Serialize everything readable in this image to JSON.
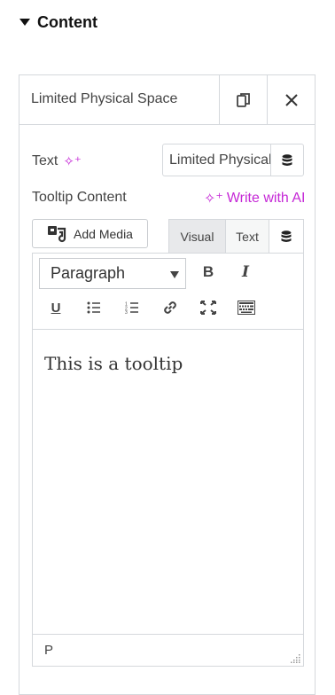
{
  "section": {
    "title": "Content"
  },
  "item": {
    "title": "Limited Physical Space"
  },
  "text_field": {
    "label": "Text",
    "value": "Limited Physical Space"
  },
  "tooltip_field": {
    "label": "Tooltip Content",
    "ai_label": "Write with AI"
  },
  "media": {
    "add_label": "Add Media"
  },
  "editor_tabs": {
    "visual": "Visual",
    "text": "Text"
  },
  "toolbar": {
    "format_value": "Paragraph",
    "bold": "B",
    "italic": "I",
    "underline": "U"
  },
  "editor": {
    "content": "This is a tooltip",
    "path": "P"
  },
  "colors": {
    "accent": "#c528d6",
    "border": "#d5d8dc"
  },
  "icons": [
    "caret-down-icon",
    "duplicate-icon",
    "close-icon",
    "sparkle-icon",
    "database-icon",
    "add-media-icon",
    "bullet-list-icon",
    "numbered-list-icon",
    "link-icon",
    "fullscreen-icon",
    "keyboard-icon",
    "resize-handle-icon"
  ]
}
